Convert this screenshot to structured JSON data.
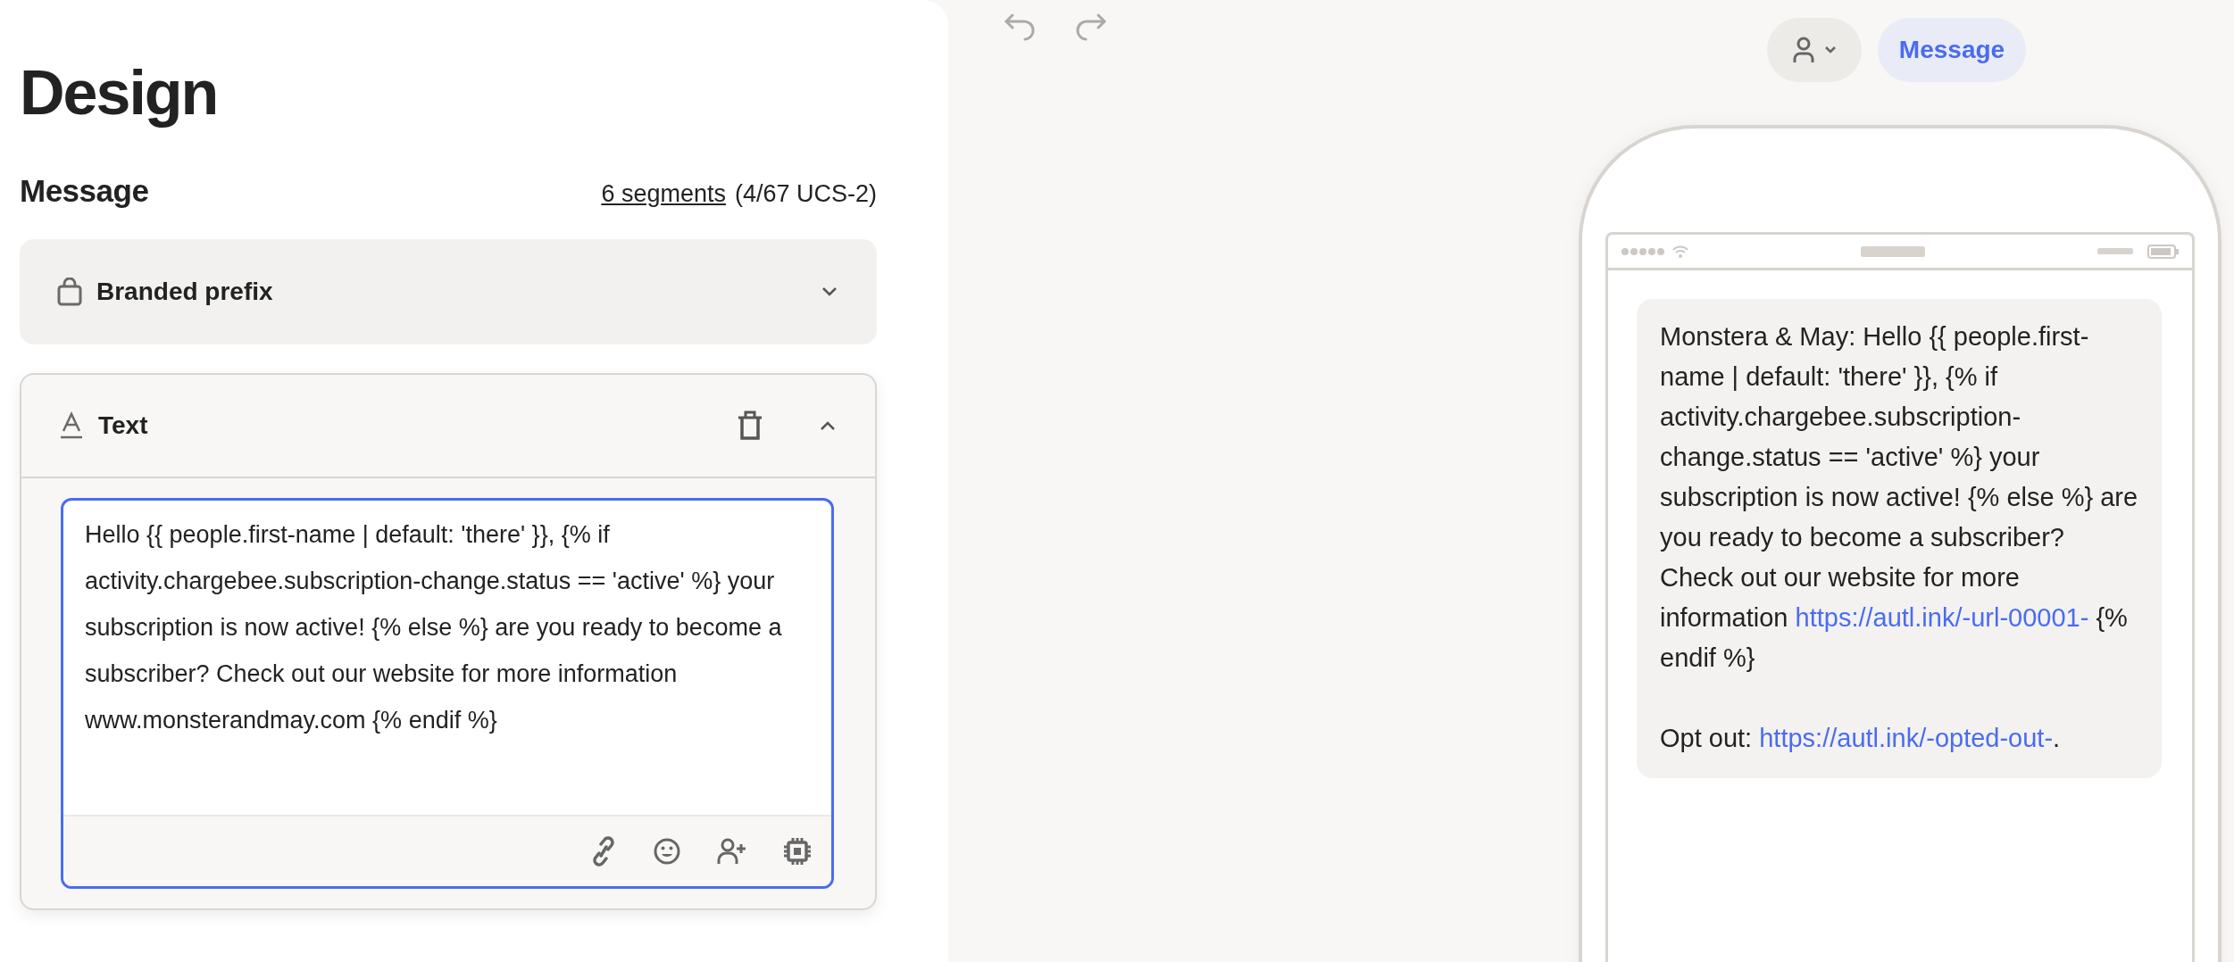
{
  "panel": {
    "title": "Design",
    "section": {
      "title": "Message",
      "segments_link": "6 segments",
      "encoding": "(4/67 UCS-2)"
    },
    "blocks": [
      {
        "kind": "prefix",
        "label": "Branded prefix",
        "expanded": false
      },
      {
        "kind": "text",
        "label": "Text",
        "expanded": true,
        "value": "Hello {{ people.first-name | default: 'there' }}, {% if activity.chargebee.subscription-change.status == 'active' %} your subscription is now active! {% else %} are you ready to become a subscriber? Check out our website for more information www.monsterandmay.com {% endif %}"
      }
    ]
  },
  "preview": {
    "message_button": "Message",
    "bubble": [
      [
        {
          "kind": "text",
          "text": "Monstera & May: Hello {{ people.first-name | default: 'there' }}, {% if activity.chargebee.subscription-change.status == 'active' %} your subscription is now active! {% else %} are you ready to become a subscriber? Check out our website for more information "
        },
        {
          "kind": "link",
          "text": "https://autl.ink/-url-00001-"
        },
        {
          "kind": "text",
          "text": " {% endif %}"
        }
      ],
      [
        {
          "kind": "text",
          "text": "Opt out: "
        },
        {
          "kind": "link",
          "text": "https://autl.ink/-opted-out-"
        },
        {
          "kind": "text",
          "text": "."
        }
      ]
    ]
  }
}
